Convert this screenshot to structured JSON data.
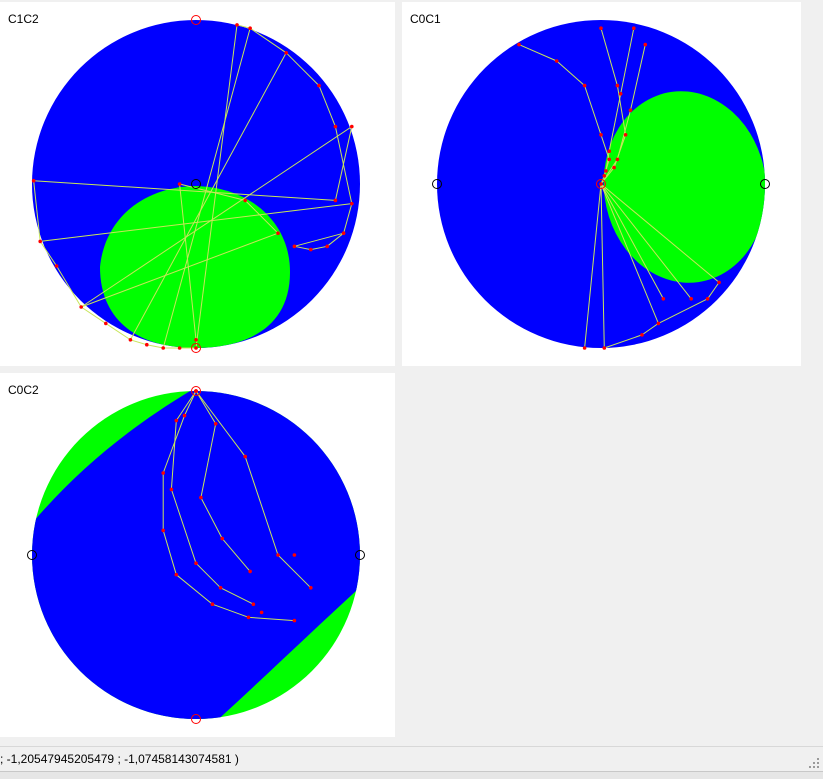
{
  "window": {
    "background_color": "#f0f0f0",
    "panel_background": "#ffffff"
  },
  "colors": {
    "disk": "#0000ff",
    "region": "#00ff00",
    "path_line": "#c8e65a",
    "path_point": "#ff0000",
    "marker_circle_red": "#ff0000",
    "marker_circle_black": "#000000"
  },
  "panels": [
    {
      "id": "c1c2",
      "title": "C1C2",
      "points": [
        [
          -0.99,
          0.02
        ],
        [
          -0.95,
          -0.35
        ],
        [
          -0.85,
          -0.5
        ],
        [
          -0.7,
          -0.75
        ],
        [
          -0.55,
          -0.85
        ],
        [
          -0.4,
          -0.95
        ],
        [
          -0.3,
          -0.98
        ],
        [
          -0.2,
          -1.0
        ],
        [
          -0.1,
          -1.0
        ],
        [
          0.0,
          -1.0
        ],
        [
          0.25,
          0.97
        ],
        [
          0.33,
          0.95
        ],
        [
          0.55,
          0.8
        ],
        [
          0.75,
          0.6
        ],
        [
          0.85,
          0.35
        ],
        [
          0.95,
          -0.12
        ],
        [
          0.9,
          -0.3
        ],
        [
          0.8,
          -0.38
        ],
        [
          0.7,
          -0.4
        ],
        [
          0.6,
          -0.38
        ],
        [
          0.95,
          0.35
        ],
        [
          0.85,
          -0.1
        ],
        [
          0.5,
          -0.3
        ],
        [
          0.3,
          -0.1
        ],
        [
          -0.1,
          0.0
        ],
        [
          0.0,
          -0.95
        ]
      ],
      "segments": [
        [
          0,
          1
        ],
        [
          1,
          2
        ],
        [
          2,
          3
        ],
        [
          3,
          4
        ],
        [
          4,
          5
        ],
        [
          5,
          6
        ],
        [
          6,
          7
        ],
        [
          7,
          8
        ],
        [
          8,
          9
        ],
        [
          10,
          11
        ],
        [
          11,
          12
        ],
        [
          12,
          13
        ],
        [
          13,
          14
        ],
        [
          14,
          15
        ],
        [
          15,
          16
        ],
        [
          16,
          17
        ],
        [
          17,
          18
        ],
        [
          18,
          19
        ],
        [
          0,
          21
        ],
        [
          21,
          20
        ],
        [
          20,
          3
        ],
        [
          1,
          15
        ],
        [
          10,
          9
        ],
        [
          11,
          7
        ],
        [
          3,
          22
        ],
        [
          22,
          23
        ],
        [
          23,
          24
        ],
        [
          24,
          25
        ],
        [
          5,
          12
        ],
        [
          19,
          16
        ]
      ],
      "markers": [
        {
          "x": 0.0,
          "y": 1.0,
          "color": "red"
        },
        {
          "x": 0.0,
          "y": 0.0,
          "color": "black"
        },
        {
          "x": 0.0,
          "y": -1.0,
          "color": "red"
        }
      ]
    },
    {
      "id": "c0c1",
      "title": "C0C1",
      "points": [
        [
          -0.5,
          0.85
        ],
        [
          -0.27,
          0.75
        ],
        [
          -0.1,
          0.6
        ],
        [
          0.0,
          0.3
        ],
        [
          0.05,
          0.15
        ],
        [
          0.02,
          0.05
        ],
        [
          0.0,
          0.95
        ],
        [
          0.1,
          0.6
        ],
        [
          0.15,
          0.3
        ],
        [
          0.08,
          0.1
        ],
        [
          0.2,
          0.95
        ],
        [
          0.12,
          0.55
        ],
        [
          0.05,
          0.2
        ],
        [
          0.27,
          0.85
        ],
        [
          0.18,
          0.45
        ],
        [
          0.1,
          0.15
        ],
        [
          0.0,
          0.0
        ],
        [
          0.03,
          0.08
        ],
        [
          0.38,
          -0.7
        ],
        [
          0.55,
          -0.7
        ],
        [
          0.72,
          -0.6
        ],
        [
          0.65,
          -0.7
        ],
        [
          0.35,
          -0.85
        ],
        [
          0.25,
          -0.92
        ],
        [
          0.02,
          -1.0
        ],
        [
          -0.1,
          -1.0
        ]
      ],
      "segments": [
        [
          0,
          1
        ],
        [
          1,
          2
        ],
        [
          2,
          3
        ],
        [
          3,
          4
        ],
        [
          4,
          5
        ],
        [
          5,
          16
        ],
        [
          6,
          7
        ],
        [
          7,
          8
        ],
        [
          8,
          9
        ],
        [
          9,
          16
        ],
        [
          10,
          11
        ],
        [
          11,
          12
        ],
        [
          12,
          17
        ],
        [
          13,
          14
        ],
        [
          14,
          15
        ],
        [
          15,
          16
        ],
        [
          16,
          18
        ],
        [
          16,
          19
        ],
        [
          16,
          20
        ],
        [
          20,
          21
        ],
        [
          21,
          22
        ],
        [
          22,
          23
        ],
        [
          23,
          24
        ],
        [
          16,
          25
        ],
        [
          16,
          24
        ],
        [
          16,
          22
        ]
      ],
      "markers": [
        {
          "x": -1.0,
          "y": 0.0,
          "color": "black"
        },
        {
          "x": 1.0,
          "y": 0.0,
          "color": "black"
        },
        {
          "x": 0.0,
          "y": 0.0,
          "color": "red"
        }
      ]
    },
    {
      "id": "c0c2",
      "title": "C0C2",
      "points": [
        [
          0.0,
          1.0
        ],
        [
          -0.07,
          0.85
        ],
        [
          -0.2,
          0.5
        ],
        [
          -0.2,
          0.15
        ],
        [
          -0.12,
          -0.12
        ],
        [
          0.1,
          -0.3
        ],
        [
          0.32,
          -0.38
        ],
        [
          0.6,
          -0.4
        ],
        [
          0.0,
          1.0
        ],
        [
          -0.12,
          0.82
        ],
        [
          -0.15,
          0.4
        ],
        [
          0.0,
          -0.05
        ],
        [
          0.15,
          -0.2
        ],
        [
          0.35,
          -0.3
        ],
        [
          0.0,
          1.0
        ],
        [
          0.12,
          0.8
        ],
        [
          0.03,
          0.35
        ],
        [
          0.16,
          0.1
        ],
        [
          0.33,
          -0.1
        ],
        [
          0.4,
          -0.35
        ],
        [
          0.0,
          1.0
        ],
        [
          0.3,
          0.6
        ],
        [
          0.5,
          0.0
        ],
        [
          0.6,
          0.0
        ],
        [
          0.7,
          -0.2
        ]
      ],
      "segments": [
        [
          0,
          1
        ],
        [
          1,
          2
        ],
        [
          2,
          3
        ],
        [
          3,
          4
        ],
        [
          4,
          5
        ],
        [
          5,
          6
        ],
        [
          6,
          7
        ],
        [
          8,
          9
        ],
        [
          9,
          10
        ],
        [
          10,
          11
        ],
        [
          11,
          12
        ],
        [
          12,
          13
        ],
        [
          14,
          15
        ],
        [
          15,
          16
        ],
        [
          16,
          17
        ],
        [
          17,
          18
        ],
        [
          20,
          21
        ],
        [
          21,
          22
        ],
        [
          22,
          24
        ]
      ],
      "markers": [
        {
          "x": 0.0,
          "y": 1.0,
          "color": "red"
        },
        {
          "x": -1.0,
          "y": 0.0,
          "color": "black"
        },
        {
          "x": 1.0,
          "y": 0.0,
          "color": "black"
        },
        {
          "x": 0.0,
          "y": -1.0,
          "color": "red"
        }
      ]
    }
  ],
  "status_bar": {
    "text": "; -1,20547945205479 ; -1,07458143074581 )"
  },
  "icons": {
    "resize_grip": "resize-grip-icon"
  }
}
